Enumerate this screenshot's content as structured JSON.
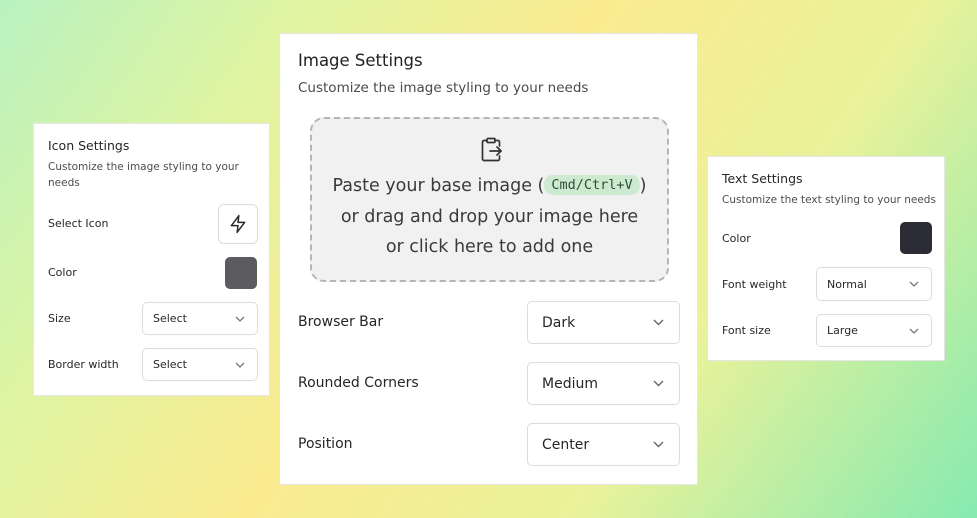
{
  "icon_settings": {
    "title": "Icon Settings",
    "subtitle": "Customize the image styling to your needs",
    "select_icon_label": "Select Icon",
    "selected_icon": "lightning-bolt-icon",
    "color_label": "Color",
    "color_value": "#5c5c60",
    "size_label": "Size",
    "size_value": "Select",
    "border_width_label": "Border width",
    "border_width_value": "Select"
  },
  "image_settings": {
    "title": "Image Settings",
    "subtitle": "Customize the image styling to your needs",
    "dropzone": {
      "icon": "clipboard-paste-icon",
      "line1_prefix": "Paste your base image (",
      "shortcut": "Cmd/Ctrl+V",
      "line1_suffix": ")",
      "line2": "or drag and drop your image here",
      "line3": "or click here to add one"
    },
    "browser_bar_label": "Browser Bar",
    "browser_bar_value": "Dark",
    "rounded_corners_label": "Rounded Corners",
    "rounded_corners_value": "Medium",
    "position_label": "Position",
    "position_value": "Center"
  },
  "text_settings": {
    "title": "Text Settings",
    "subtitle": "Customize the text styling to your needs",
    "color_label": "Color",
    "color_value": "#2b2c36",
    "font_weight_label": "Font weight",
    "font_weight_value": "Normal",
    "font_size_label": "Font size",
    "font_size_value": "Large"
  }
}
